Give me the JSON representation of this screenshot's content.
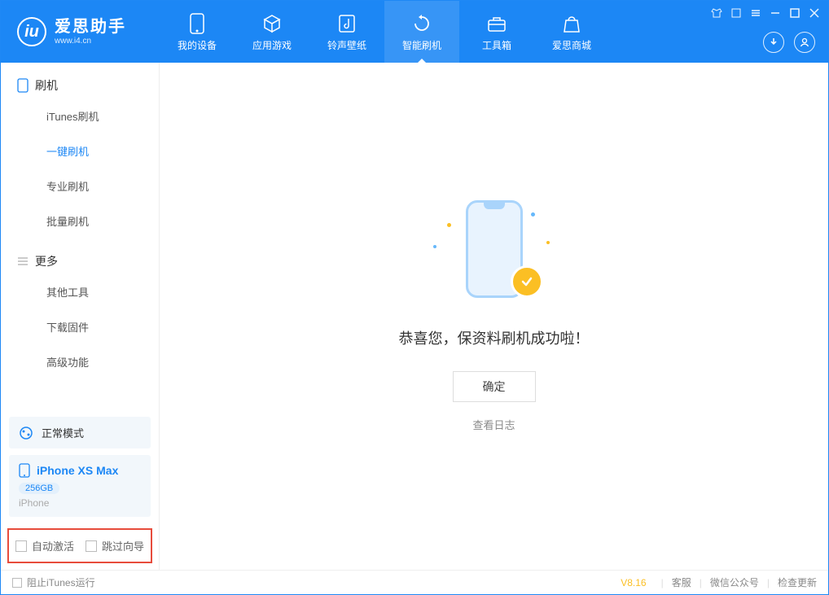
{
  "logo": {
    "title": "爱思助手",
    "sub": "www.i4.cn",
    "mark": "iu"
  },
  "nav": [
    {
      "label": "我的设备"
    },
    {
      "label": "应用游戏"
    },
    {
      "label": "铃声壁纸"
    },
    {
      "label": "智能刷机"
    },
    {
      "label": "工具箱"
    },
    {
      "label": "爱思商城"
    }
  ],
  "sidebar": {
    "group1": "刷机",
    "items1": [
      {
        "label": "iTunes刷机"
      },
      {
        "label": "一键刷机"
      },
      {
        "label": "专业刷机"
      },
      {
        "label": "批量刷机"
      }
    ],
    "group2": "更多",
    "items2": [
      {
        "label": "其他工具"
      },
      {
        "label": "下载固件"
      },
      {
        "label": "高级功能"
      }
    ],
    "mode": "正常模式",
    "device": {
      "name": "iPhone XS Max",
      "storage": "256GB",
      "type": "iPhone"
    },
    "options": {
      "auto_activate": "自动激活",
      "skip_wizard": "跳过向导"
    }
  },
  "main": {
    "success_msg": "恭喜您，保资料刷机成功啦！",
    "ok_btn": "确定",
    "view_log": "查看日志"
  },
  "footer": {
    "block_itunes": "阻止iTunes运行",
    "version": "V8.16",
    "links": [
      "客服",
      "微信公众号",
      "检查更新"
    ]
  }
}
